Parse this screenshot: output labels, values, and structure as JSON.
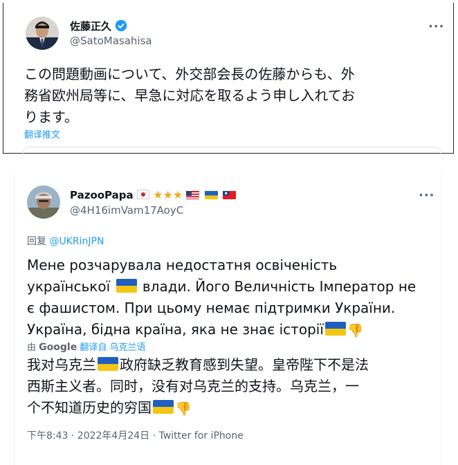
{
  "tweet1": {
    "display_name": "佐藤正久",
    "handle": "@SatoMasahisa",
    "more_label": "···",
    "lines": [
      "この問題動画について、外交部会長の佐藤からも、外",
      "務省欧州局等に、早急に対応を取るよう申し入れてお",
      "ります。"
    ],
    "translate_label": "翻译推文",
    "verified_icon": "verified-badge-icon",
    "colors": {
      "verified": "#1d9bf0",
      "link": "#1d9bf0"
    }
  },
  "tweet2": {
    "display_name": "PazooPapa",
    "name_decorations": [
      "japan-flag-icon",
      "star-icon",
      "star-icon",
      "star-icon",
      "usa-flag-icon",
      "ukraine-flag-icon",
      "taiwan-flag-icon"
    ],
    "handle": "@4H16imVam17AoyC",
    "more_label": "···",
    "reply_prefix": "回复",
    "reply_to": "@UKRinJPN",
    "uk_lines": [
      "Мене розчарувала недостатня освіченість",
      "української",
      "влади.  Його Величність Імператор не",
      "є фашистом.  При цьому немає підтримки України.",
      "Україна, бідна країна, яка не знає історії"
    ],
    "translation_by": "由",
    "translation_provider": "Google",
    "translation_label": "翻译自 乌克兰语",
    "zh_lines": [
      "我对乌克兰",
      "政府缺乏教育感到失望。皇帝陛下不是法",
      "西斯主义者。同时，没有对乌克兰的支持。乌克兰，一",
      "个不知道历史的穷国"
    ],
    "timestamp": "下午8:43 · 2022年4月24日 · Twitter for iPhone",
    "colors": {
      "link": "#1d9bf0",
      "flag_blue": "#1f5fbf",
      "flag_yellow": "#f2c713"
    }
  }
}
